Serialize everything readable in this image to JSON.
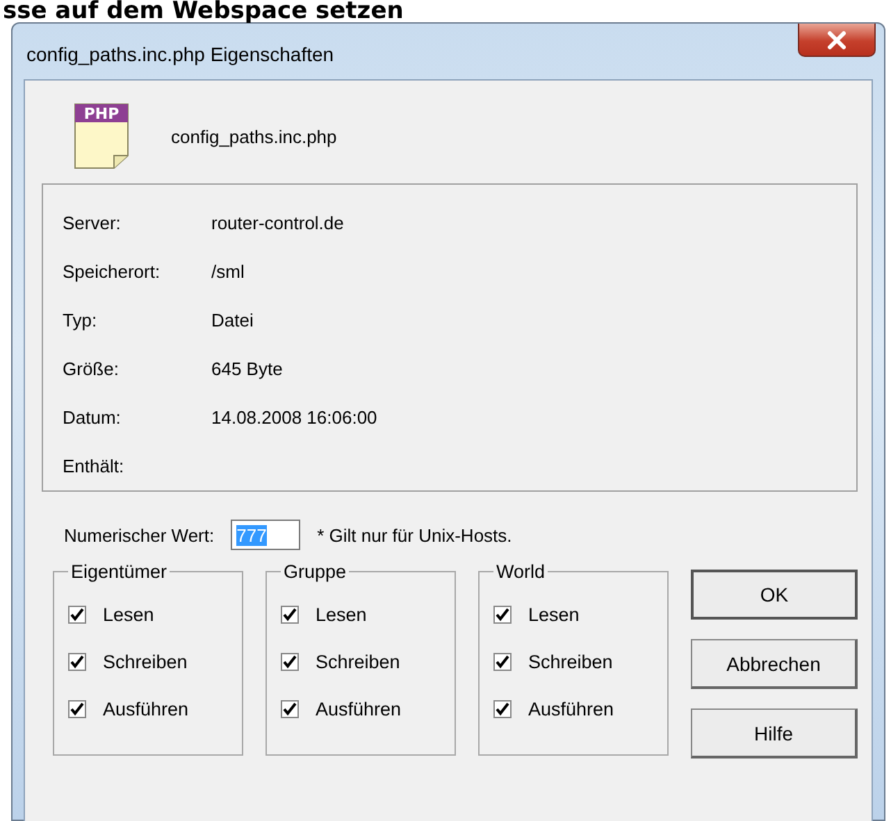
{
  "page_heading": "sse auf dem Webspace setzen",
  "window": {
    "title": "config_paths.inc.php Eigenschaften"
  },
  "file": {
    "icon_label": "PHP",
    "name": "config_paths.inc.php"
  },
  "properties": [
    {
      "label": "Server:",
      "value": "router-control.de"
    },
    {
      "label": "Speicherort:",
      "value": "/sml"
    },
    {
      "label": "Typ:",
      "value": "Datei"
    },
    {
      "label": "Größe:",
      "value": "645  Byte"
    },
    {
      "label": "Datum:",
      "value": "14.08.2008 16:06:00"
    },
    {
      "label": "Enthält:"
    }
  ],
  "numeric": {
    "label": "Numerischer Wert:",
    "value": "777",
    "highlighted": true,
    "note": "* Gilt nur für Unix-Hosts."
  },
  "groups": [
    {
      "title": "Eigentümer",
      "options": [
        {
          "label": "Lesen",
          "checked": true
        },
        {
          "label": "Schreiben",
          "checked": true
        },
        {
          "label": "Ausführen",
          "checked": true
        }
      ]
    },
    {
      "title": "Gruppe",
      "options": [
        {
          "label": "Lesen",
          "checked": true
        },
        {
          "label": "Schreiben",
          "checked": true
        },
        {
          "label": "Ausführen",
          "checked": true
        }
      ]
    },
    {
      "title": "World",
      "options": [
        {
          "label": "Lesen",
          "checked": true
        },
        {
          "label": "Schreiben",
          "checked": true
        },
        {
          "label": "Ausführen",
          "checked": true
        }
      ]
    }
  ],
  "buttons": [
    "OK",
    "Abbrechen",
    "Hilfe"
  ]
}
